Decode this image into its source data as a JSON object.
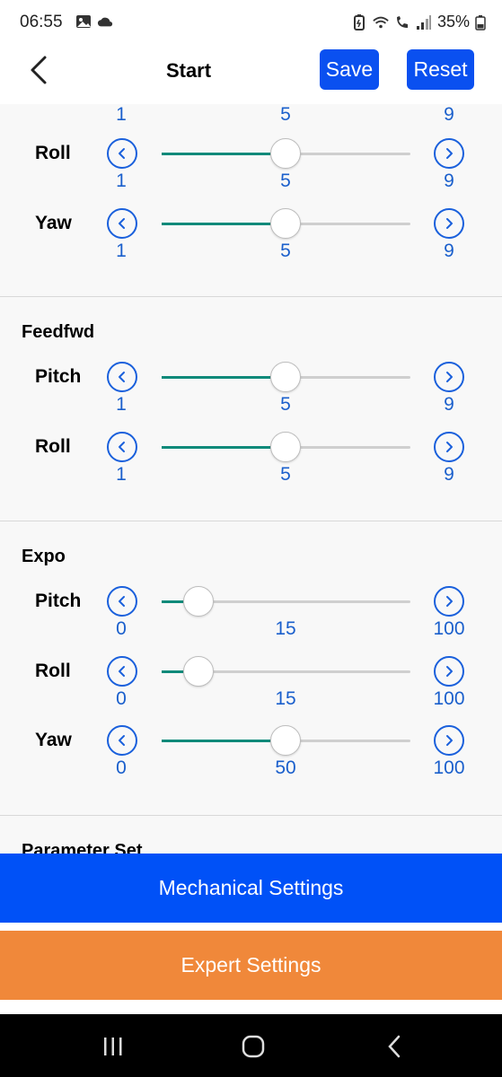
{
  "status_bar": {
    "time": "06:55",
    "battery": "35%",
    "icons_left": [
      "image-icon",
      "cloud-icon"
    ],
    "icons_right": [
      "battery-saver-icon",
      "wifi-icon",
      "wifi-call-icon",
      "signal-icon",
      "battery-icon"
    ]
  },
  "header": {
    "title": "Start",
    "save_label": "Save",
    "reset_label": "Reset"
  },
  "top_partial_ticks": {
    "min": "1",
    "val": "5",
    "max": "9"
  },
  "sections": [
    {
      "title": "",
      "rows": [
        {
          "label": "Roll",
          "min": "1",
          "value": "5",
          "max": "9",
          "fraction": 0.5
        },
        {
          "label": "Yaw",
          "min": "1",
          "value": "5",
          "max": "9",
          "fraction": 0.5
        }
      ]
    },
    {
      "title": "Feedfwd",
      "rows": [
        {
          "label": "Pitch",
          "min": "1",
          "value": "5",
          "max": "9",
          "fraction": 0.5
        },
        {
          "label": "Roll",
          "min": "1",
          "value": "5",
          "max": "9",
          "fraction": 0.5
        }
      ]
    },
    {
      "title": "Expo",
      "rows": [
        {
          "label": "Pitch",
          "min": "0",
          "value": "15",
          "max": "100",
          "fraction": 0.15
        },
        {
          "label": "Roll",
          "min": "0",
          "value": "15",
          "max": "100",
          "fraction": 0.15
        },
        {
          "label": "Yaw",
          "min": "0",
          "value": "50",
          "max": "100",
          "fraction": 0.5
        }
      ]
    },
    {
      "title": "Parameter Set",
      "rows": []
    }
  ],
  "buttons": {
    "mechanical": "Mechanical Settings",
    "expert": "Expert Settings"
  },
  "colors": {
    "primary_blue": "#0051f7",
    "orange": "#f0883a",
    "slider_fill": "#0d8a7a",
    "tick_blue": "#1a5fcc"
  }
}
